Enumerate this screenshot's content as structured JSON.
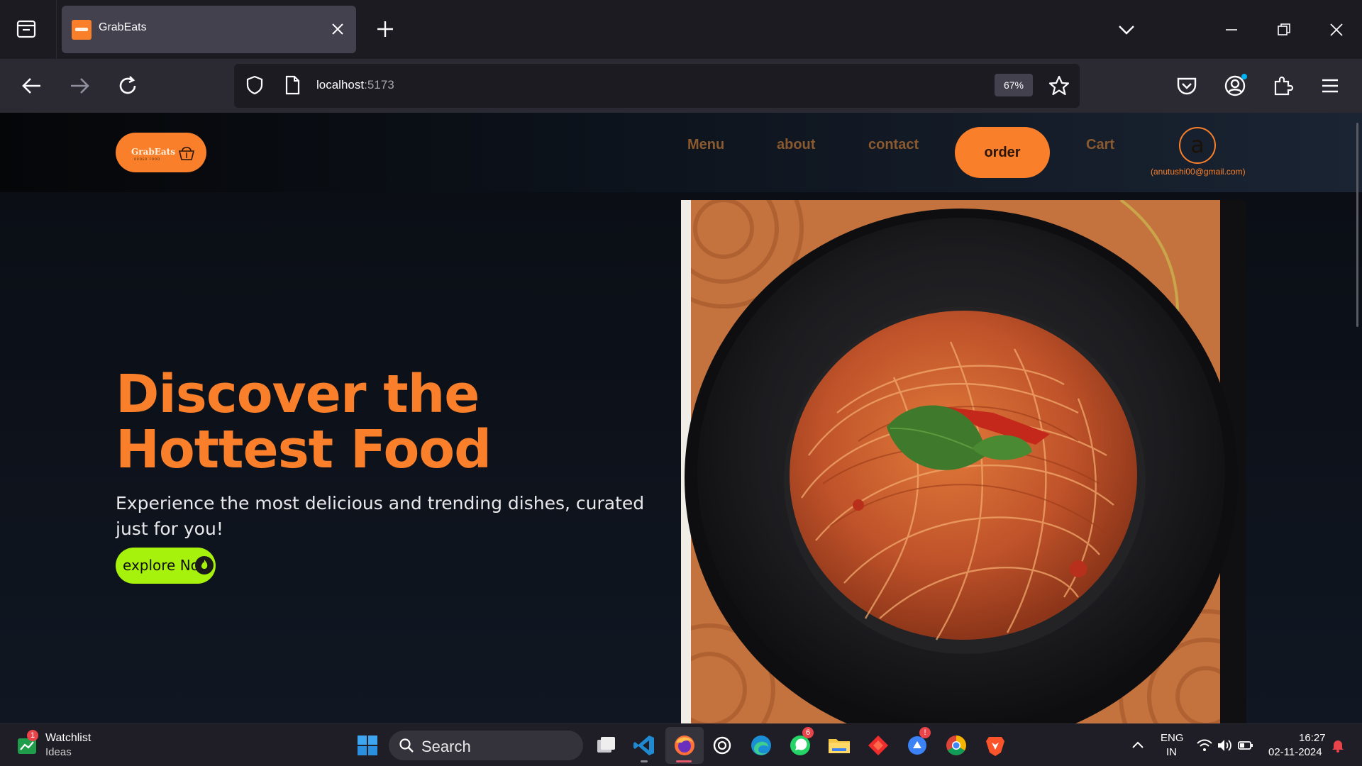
{
  "browser": {
    "tab_title": "GrabEats",
    "url_host": "localhost",
    "url_port": ":5173",
    "zoom": "67%"
  },
  "site": {
    "logo_text": "GrabEats",
    "logo_sub": "ORDER FOOD",
    "nav": [
      "Menu",
      "about",
      "contact",
      "order",
      "Cart"
    ],
    "avatar_letter": "a",
    "user_email": "(anutushi00@gmail.com)",
    "hero_title": "Discover the Hottest Food",
    "hero_subtitle": "Experience the most delicious and trending dishes, curated just for you!",
    "explore_label": "explore Now"
  },
  "colors": {
    "accent": "#f97f2a",
    "explore": "#a6f20c",
    "nav_link": "#8a5a2e"
  },
  "taskbar": {
    "watchlist_title": "Watchlist",
    "watchlist_sub": "Ideas",
    "watchlist_badge": "1",
    "search_label": "Search",
    "whatsapp_badge": "6",
    "alert_badge": "!",
    "lang_1": "ENG",
    "lang_2": "IN",
    "time": "16:27",
    "date": "02-11-2024"
  }
}
